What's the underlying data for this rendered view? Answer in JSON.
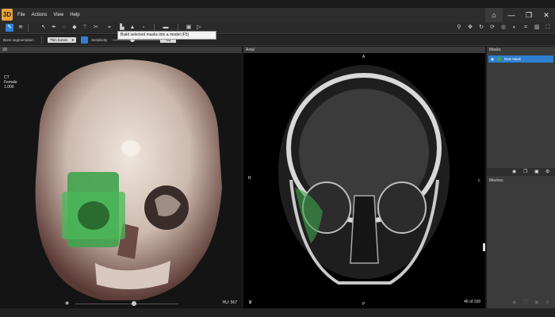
{
  "app": {
    "logo": "3D"
  },
  "menu": [
    "File",
    "Actions",
    "View",
    "Help"
  ],
  "tooltip": "Build selected masks into a model (F5)",
  "options": {
    "tool_label": "Bone segmentation",
    "preset_value": "Thin bones",
    "sensitivity_label": "Sensitivity",
    "sensitivity_value": "-53"
  },
  "view3d": {
    "header": "3D",
    "info_lines": [
      "CT",
      "Female",
      "1.000"
    ],
    "hu_readout": "HU: 567"
  },
  "axial": {
    "header": "Axial",
    "orient_top": "A",
    "orient_left": "R",
    "orient_right": "L",
    "orient_bottom": "P",
    "slice_counter": "46 of 199"
  },
  "masks": {
    "header": "Masks",
    "items": [
      {
        "name": "New Mask",
        "color": "#3fa34d"
      }
    ]
  },
  "meshes": {
    "header": "Meshes"
  },
  "colors": {
    "accent": "#2f7fd0",
    "mask_green": "#3fa34d",
    "logo": "#e8a33a"
  }
}
